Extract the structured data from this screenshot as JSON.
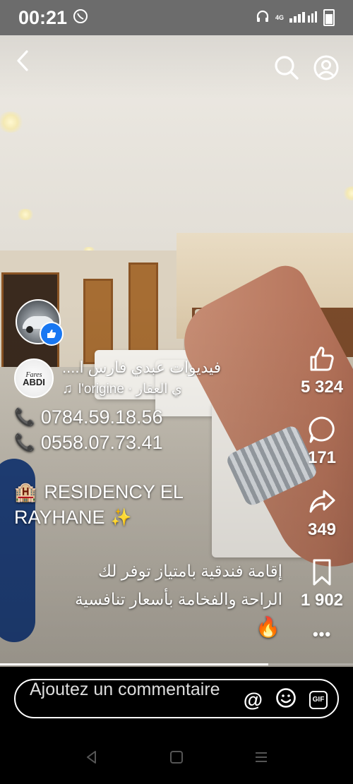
{
  "status_bar": {
    "time": "00:21",
    "network": "4G"
  },
  "top_bar": {
    "back_icon": "chevron-left-icon",
    "search_icon": "search-icon",
    "profile_icon": "profile-icon"
  },
  "actions": {
    "like_count": "5 324",
    "comment_count": "171",
    "share_count": "349",
    "save_count": "1 902",
    "more_label": "•••"
  },
  "author": {
    "name": "فيديوات عبدي فارس ا....",
    "music": "l'origine · ي العقار"
  },
  "caption": {
    "phone_1": "0784.59.18.56",
    "phone_2": "0558.07.73.41",
    "title_line1": "RESIDENCY EL",
    "title_line2": "RAYHANE",
    "arabic_line1": "إقامة فندقية بامتياز توفر لك",
    "arabic_line2": "الراحة والفخامة بأسعار تنافسية",
    "hotel_emoji": "🏨",
    "sparkle_emoji": "✨",
    "fire_emoji": "🔥",
    "phone_emoji": "📞",
    "music_note": "♫"
  },
  "progress": {
    "fraction": 0.76
  },
  "comment": {
    "placeholder": "Ajoutez un commentaire",
    "at_label": "@",
    "gif_label": "GIF"
  },
  "colors": {
    "like_badge": "#1877f2",
    "status_bar": "#6c6c6c"
  }
}
